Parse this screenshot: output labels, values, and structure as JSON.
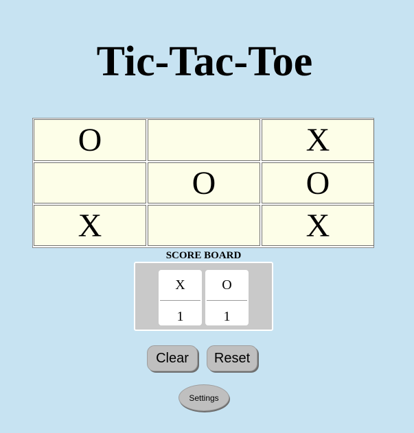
{
  "title": "Tic-Tac-Toe",
  "board": {
    "rows": [
      [
        "O",
        "",
        "X"
      ],
      [
        "",
        "O",
        "O"
      ],
      [
        "X",
        "",
        "X"
      ]
    ]
  },
  "scoreboard": {
    "title": "SCORE BOARD",
    "players": [
      {
        "name": "X",
        "score": "1"
      },
      {
        "name": "O",
        "score": "1"
      }
    ]
  },
  "buttons": {
    "clear": "Clear",
    "reset": "Reset",
    "settings": "Settings"
  },
  "colors": {
    "background": "#c7e3f2",
    "cell": "#fdfee8",
    "scorebox": "#c9c9c9",
    "button": "#bfbfbf"
  }
}
